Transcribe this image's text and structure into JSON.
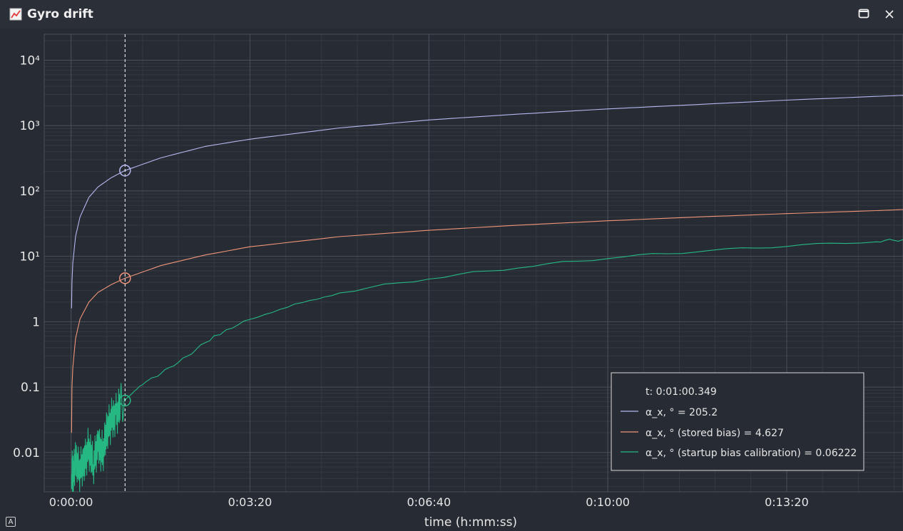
{
  "window": {
    "title": "Gyro drift",
    "icon": "chart-icon",
    "buttons": {
      "maximize": "maximize-icon",
      "close": "close-icon"
    }
  },
  "axis_button": {
    "label": "A"
  },
  "colors": {
    "background": "#272b33",
    "titlebar": "#2b2f37",
    "grid": "#4a4f58",
    "grid_minor": "#353a42",
    "text": "#e6e6e6",
    "cursor": "#ffffff",
    "legend_border": "#d8d8d8"
  },
  "legend": {
    "time_label": "t: 0:01:00.349",
    "entries": [
      {
        "label": "α_x, ° = 205.2",
        "color": "#b4b8f0"
      },
      {
        "label": "α_x, ° (stored bias) = 4.627",
        "color": "#f0957a"
      },
      {
        "label": "α_x, ° (startup bias calibration) = 0.06222",
        "color": "#25b883"
      }
    ]
  },
  "chart_data": {
    "type": "line",
    "title": "",
    "xlabel": "time (h:mm:ss)",
    "ylabel": "",
    "x_tick_labels": [
      "0:00:00",
      "0:03:20",
      "0:06:40",
      "0:10:00",
      "0:13:20"
    ],
    "x_ticks_seconds": [
      0,
      200,
      400,
      600,
      800
    ],
    "xlim": [
      -30,
      930
    ],
    "y_scale": "log",
    "y_tick_labels": [
      "0.01",
      "0.1",
      "1",
      "10¹",
      "10²",
      "10³",
      "10⁴"
    ],
    "y_ticks": [
      0.01,
      0.1,
      1,
      10,
      100,
      1000,
      10000
    ],
    "ylim": [
      0.0025,
      25000
    ],
    "grid": true,
    "legend_position": "bottom-right",
    "cursor": {
      "x_seconds": 60.349
    },
    "series": [
      {
        "color": "#b4b8f0",
        "x": [
          0.5,
          1,
          2,
          5,
          10,
          20,
          30,
          45,
          60.349,
          100,
          150,
          200,
          300,
          400,
          500,
          600,
          700,
          800,
          900,
          930
        ],
        "y": [
          1.6,
          4,
          8,
          20,
          40,
          80,
          115,
          160,
          205.2,
          320,
          480,
          620,
          920,
          1220,
          1500,
          1800,
          2100,
          2450,
          2800,
          2900
        ]
      },
      {
        "color": "#f0957a",
        "x": [
          0.5,
          1,
          2,
          5,
          10,
          20,
          30,
          45,
          60.349,
          100,
          150,
          200,
          300,
          400,
          500,
          600,
          700,
          800,
          900,
          930
        ],
        "y": [
          0.02,
          0.1,
          0.2,
          0.55,
          1.1,
          2.0,
          2.8,
          3.7,
          4.627,
          7.2,
          10.5,
          14,
          20,
          25,
          30,
          35,
          40,
          45,
          50,
          52
        ]
      },
      {
        "color": "#25b883",
        "x": [
          0.5,
          2,
          5,
          10,
          15,
          20,
          25,
          30,
          35,
          40,
          45,
          50,
          55,
          60.349,
          80,
          100,
          130,
          160,
          200,
          250,
          300,
          400,
          500,
          600,
          700,
          800,
          900,
          930
        ],
        "y": [
          0.006,
          0.004,
          0.007,
          0.005,
          0.008,
          0.012,
          0.006,
          0.014,
          0.01,
          0.02,
          0.03,
          0.04,
          0.05,
          0.06222,
          0.11,
          0.16,
          0.3,
          0.6,
          1.1,
          1.9,
          2.8,
          4.6,
          6.8,
          9.5,
          12,
          14.5,
          17,
          18
        ]
      }
    ]
  }
}
